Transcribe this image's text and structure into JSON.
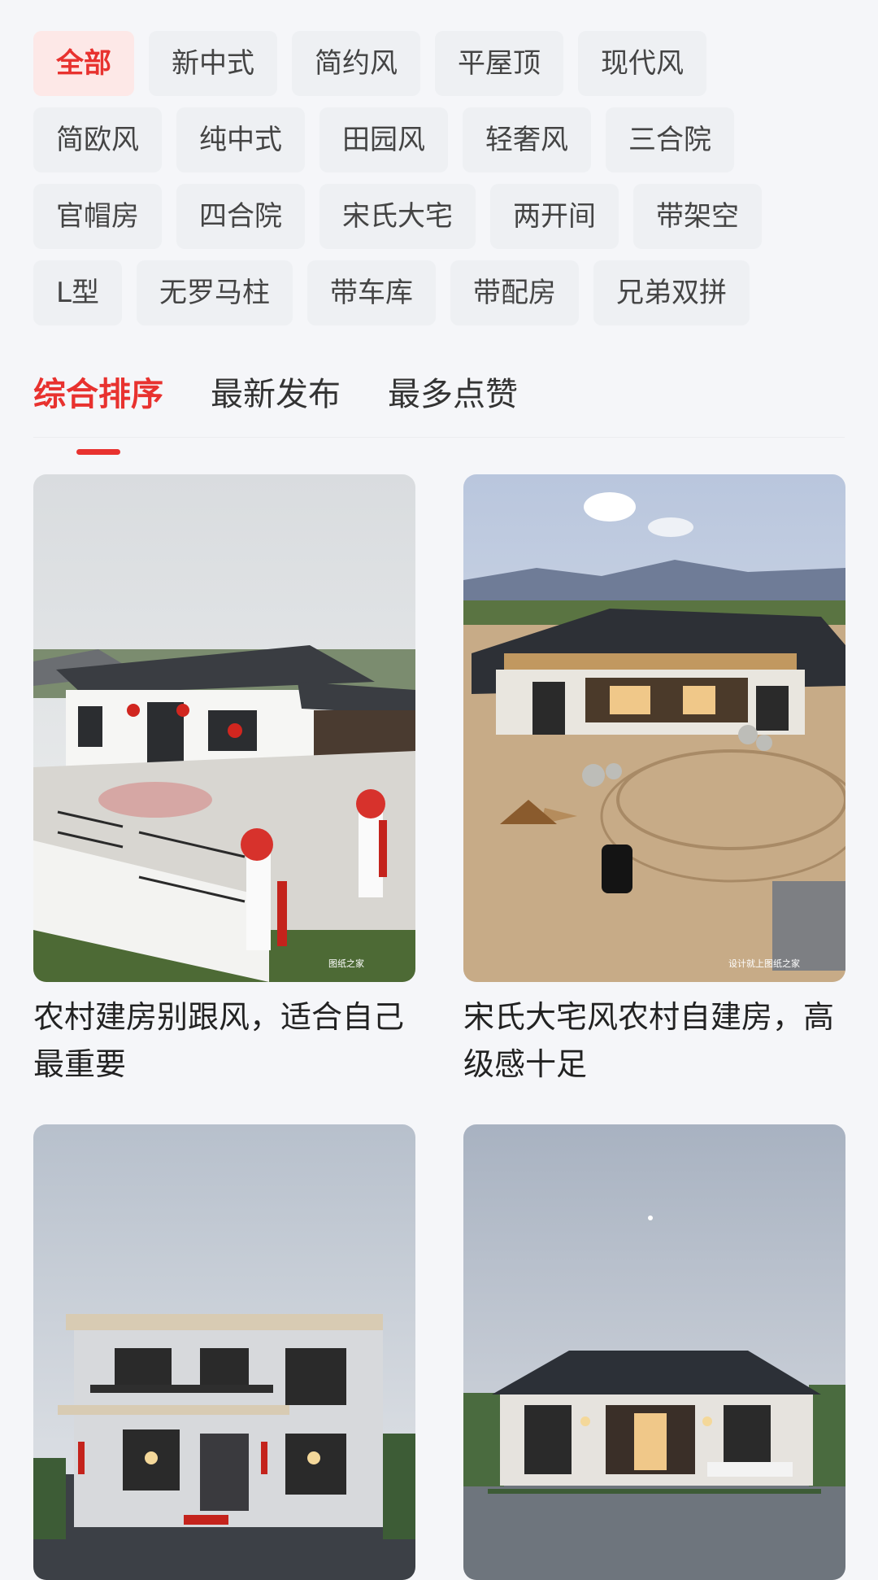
{
  "filter_chips": [
    [
      "全部",
      "新中式",
      "简约风",
      "平屋顶",
      "现代风"
    ],
    [
      "简欧风",
      "纯中式",
      "田园风",
      "轻奢风",
      "三合院"
    ],
    [
      "官帽房",
      "四合院",
      "宋氏大宅",
      "两开间",
      "带架空"
    ],
    [
      "L型",
      "无罗马柱",
      "带车库",
      "带配房",
      "兄弟双拼"
    ]
  ],
  "sort_tabs": [
    {
      "label": "综合排序",
      "active": true
    },
    {
      "label": "最新发布",
      "active": false
    },
    {
      "label": "最多点赞",
      "active": false
    }
  ],
  "cards": [
    {
      "title": "农村建房别跟风，适合自己最重要",
      "watermark": "图纸之家"
    },
    {
      "title": "宋氏大宅风农村自建房，高级感十足",
      "watermark": "设计就上图纸之家"
    },
    {
      "title": "",
      "watermark": ""
    },
    {
      "title": "",
      "watermark": ""
    }
  ],
  "colors": {
    "accent": "#e8322f",
    "background": "#f5f6f9",
    "chip_bg": "#eef0f3"
  }
}
